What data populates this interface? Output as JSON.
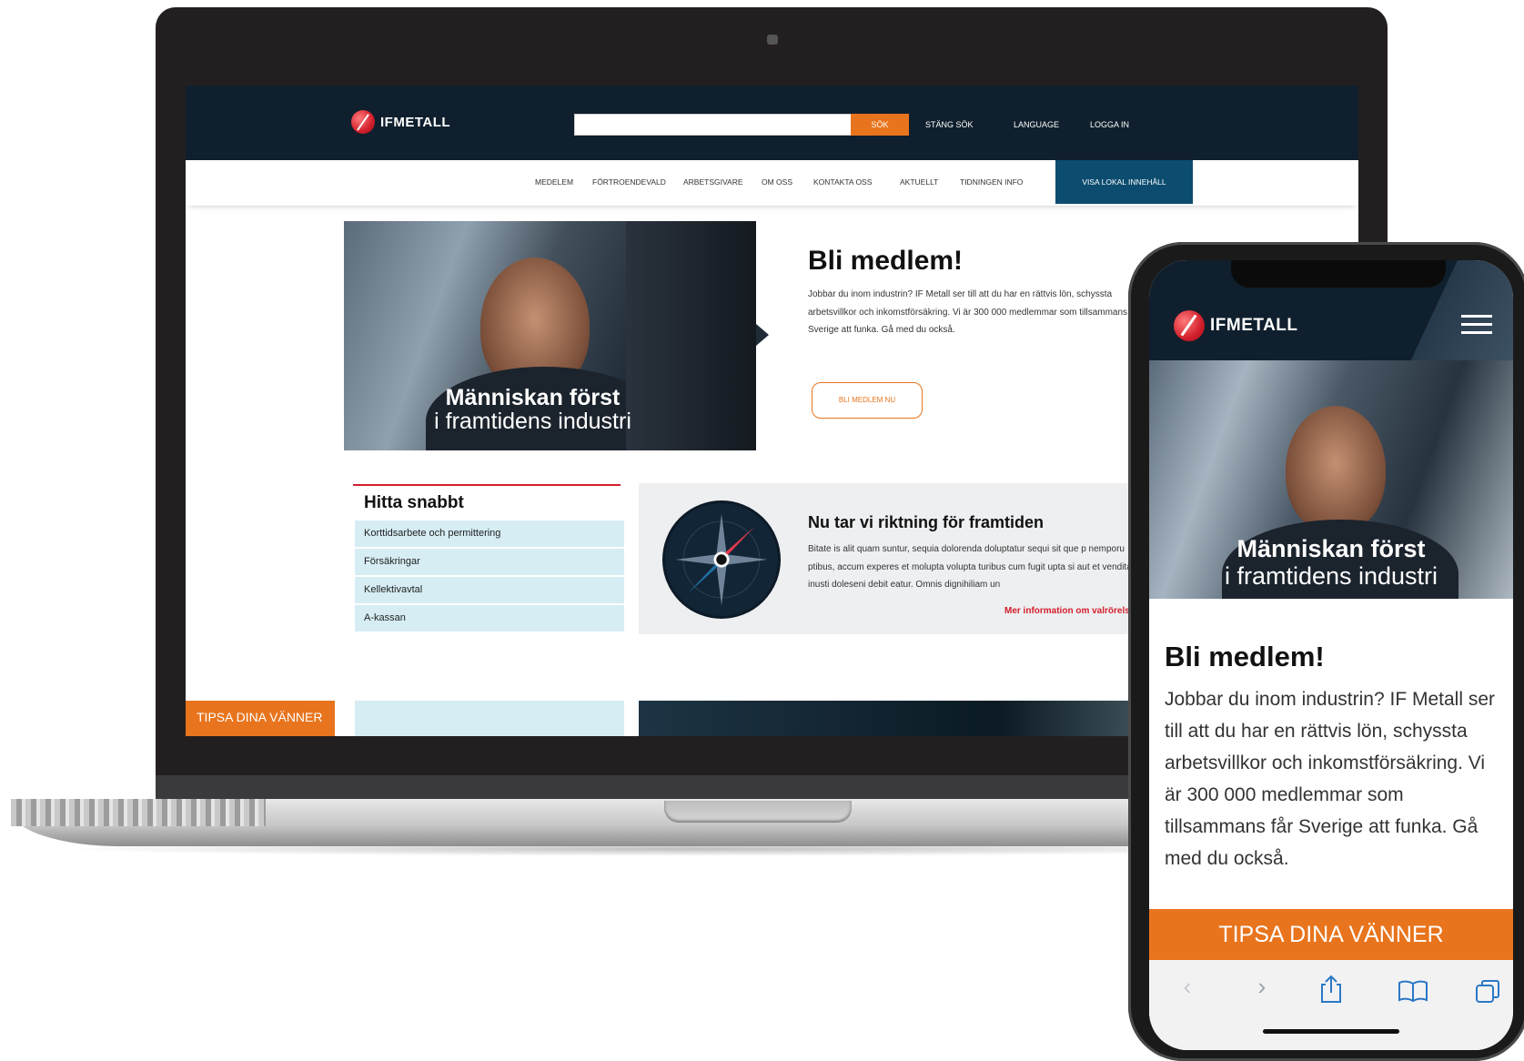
{
  "desktop": {
    "logo_text": "IFMETALL",
    "search": {
      "placeholder": "",
      "button": "SÖK"
    },
    "header_links": [
      "STÄNG SÖK",
      "LANGUAGE",
      "LOGGA IN"
    ],
    "nav": [
      "MEDELEM",
      "FÖRTROENDEVALD",
      "ARBETSGIVARE",
      "OM OSS",
      "KONTAKTA OSS",
      "AKTUELLT",
      "TIDNINGEN INFO"
    ],
    "nav_highlight": "VISA LOKAL INNEHÅLL",
    "hero": {
      "line1": "Människan först",
      "line2": "i framtidens industri"
    },
    "join": {
      "title": "Bli medlem!",
      "text": "Jobbar du inom industrin? IF Metall ser till att du har en rättvis lön, schyssta arbetsvillkor och inkomstförsäkring. Vi är 300 000 medlemmar som tillsammans får Sverige att funka. Gå med du också.",
      "button": "BLI MEDLEM NU"
    },
    "quick": {
      "title": "Hitta snabbt",
      "items": [
        "Korttidsarbete och permittering",
        "Försäkringar",
        "Kellektivavtal",
        "A-kassan"
      ]
    },
    "direction": {
      "title": "Nu tar vi riktning för framtiden",
      "text": "Bitate is alit quam suntur, sequia dolorenda doluptatur sequi sit que p nemporu ptibus, accum experes et molupta volupta turibus cum fugit upta si aut et vendita inusti doleseni debit eatur. Omnis dignihiliam un",
      "link": "Mer information om valrörelsen"
    },
    "tips": "TIPSA DINA VÄNNER"
  },
  "mobile": {
    "logo_text": "IFMETALL",
    "hero": {
      "line1": "Människan först",
      "line2": "i framtidens industri"
    },
    "join": {
      "title": "Bli medlem!",
      "text": "Jobbar du inom industrin? IF Metall ser till att du har en rättvis lön, schyssta arbetsvillkor och inkomstförsäkring. Vi är 300 000 medlemmar som tillsammans får Sverige att funka. Gå med du också."
    },
    "tips": "TIPSA DINA VÄNNER",
    "browser_icons": [
      "back-icon",
      "forward-icon",
      "share-icon",
      "bookmarks-icon",
      "tabs-icon"
    ]
  },
  "colors": {
    "navy": "#0f1f2d",
    "orange": "#e8741d",
    "red": "#d21f2b",
    "lightblue": "#d5edf3",
    "lokal": "#0c4c6f"
  }
}
